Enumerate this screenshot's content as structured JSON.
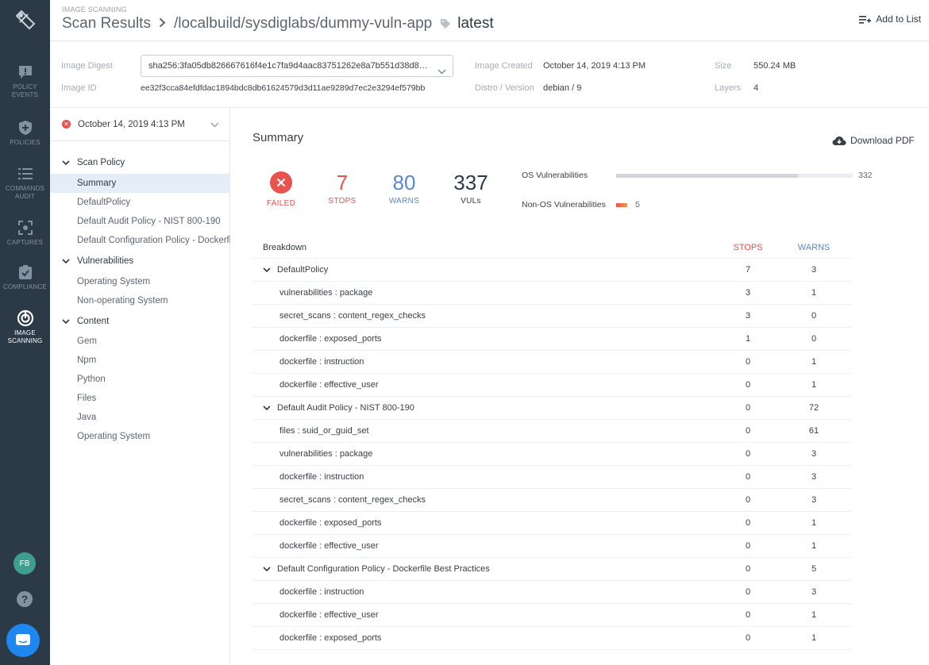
{
  "app": {
    "nav": [
      {
        "icon": "policy-events-icon",
        "label": "POLICY EVENTS"
      },
      {
        "icon": "policies-icon",
        "label": "POLICIES"
      },
      {
        "icon": "commands-audit-icon",
        "label": "COMMANDS AUDIT"
      },
      {
        "icon": "captures-icon",
        "label": "CAPTURES"
      },
      {
        "icon": "compliance-icon",
        "label": "COMPLIANCE"
      },
      {
        "icon": "image-scanning-icon",
        "label": "IMAGE SCANNING"
      }
    ],
    "user_initials": "FB",
    "help_glyph": "?"
  },
  "header": {
    "eyebrow": "IMAGE SCANNING",
    "crumb": "Scan Results",
    "repo": "/localbuild/sysdiglabs/dummy-vuln-app",
    "tag": "latest",
    "add_to_list": "Add to List"
  },
  "meta": {
    "digest_label": "Image Digest",
    "digest_value": "sha256:3fa05db826667616f4e1c7fa9d4aac83751262e8a7b551d38d8a7...",
    "id_label": "Image ID",
    "id_value": "ee32f3cca84efdfdac1894bdc8db61624579d3d11ae9289d7ec2e3294ef579bb",
    "created_label": "Image Created",
    "created_value": "October 14, 2019 4:13 PM",
    "distro_label": "Distro / Version",
    "distro_value": "debian / 9",
    "size_label": "Size",
    "size_value": "550.24 MB",
    "layers_label": "Layers",
    "layers_value": "4"
  },
  "side": {
    "scan_date": "October 14, 2019 4:13 PM",
    "groups": [
      {
        "label": "Scan Policy",
        "items": [
          "Summary",
          "DefaultPolicy",
          "Default Audit Policy - NIST 800-190",
          "Default Configuration Policy - Dockerfile Best Practices"
        ]
      },
      {
        "label": "Vulnerabilities",
        "items": [
          "Operating System",
          "Non-operating System"
        ]
      },
      {
        "label": "Content",
        "items": [
          "Gem",
          "Npm",
          "Python",
          "Files",
          "Java",
          "Operating System"
        ]
      }
    ]
  },
  "summary": {
    "title": "Summary",
    "download_pdf": "Download PDF",
    "status": "FAILED",
    "stops": "7",
    "stops_label": "STOPS",
    "warns": "80",
    "warns_label": "WARNS",
    "vuls": "337",
    "vuls_label": "VULs",
    "os_label": "OS Vulnerabilities",
    "os_value": "332",
    "os_fraction": 0.77,
    "non_os_label": "Non-OS Vulnerabilities",
    "non_os_value": "5",
    "non_os_fraction": 0.012
  },
  "breakdown": {
    "header": {
      "name": "Breakdown",
      "stops": "STOPS",
      "warns": "WARNS"
    },
    "rows": [
      {
        "kind": "group",
        "name": "DefaultPolicy",
        "stops": "7",
        "warns": "3"
      },
      {
        "kind": "item",
        "name": "vulnerabilities : package",
        "stops": "3",
        "warns": "1"
      },
      {
        "kind": "item",
        "name": "secret_scans : content_regex_checks",
        "stops": "3",
        "warns": "0"
      },
      {
        "kind": "item",
        "name": "dockerfile : exposed_ports",
        "stops": "1",
        "warns": "0"
      },
      {
        "kind": "item",
        "name": "dockerfile : instruction",
        "stops": "0",
        "warns": "1"
      },
      {
        "kind": "item",
        "name": "dockerfile : effective_user",
        "stops": "0",
        "warns": "1"
      },
      {
        "kind": "group",
        "name": "Default Audit Policy - NIST 800-190",
        "stops": "0",
        "warns": "72"
      },
      {
        "kind": "item",
        "name": "files : suid_or_guid_set",
        "stops": "0",
        "warns": "61"
      },
      {
        "kind": "item",
        "name": "vulnerabilities : package",
        "stops": "0",
        "warns": "3"
      },
      {
        "kind": "item",
        "name": "dockerfile : instruction",
        "stops": "0",
        "warns": "3"
      },
      {
        "kind": "item",
        "name": "secret_scans : content_regex_checks",
        "stops": "0",
        "warns": "3"
      },
      {
        "kind": "item",
        "name": "dockerfile : exposed_ports",
        "stops": "0",
        "warns": "1"
      },
      {
        "kind": "item",
        "name": "dockerfile : effective_user",
        "stops": "0",
        "warns": "1"
      },
      {
        "kind": "group",
        "name": "Default Configuration Policy - Dockerfile Best Practices",
        "stops": "0",
        "warns": "5"
      },
      {
        "kind": "item",
        "name": "dockerfile : instruction",
        "stops": "0",
        "warns": "3"
      },
      {
        "kind": "item",
        "name": "dockerfile : effective_user",
        "stops": "0",
        "warns": "1"
      },
      {
        "kind": "item",
        "name": "dockerfile : exposed_ports",
        "stops": "0",
        "warns": "1"
      }
    ]
  },
  "colors": {
    "nav_bg": "#2c3a47",
    "stop_red": "#e8524f",
    "warn_blue": "#5a87d6",
    "active_item_bg": "#e5eef8"
  }
}
